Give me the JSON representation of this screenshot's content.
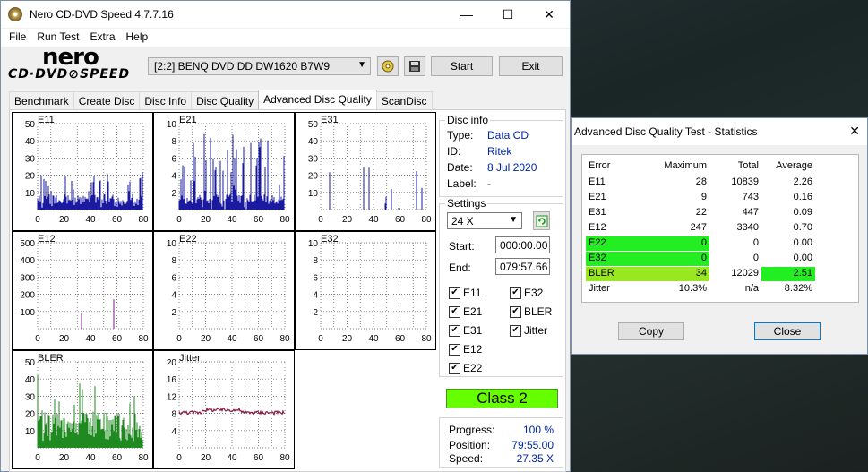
{
  "window": {
    "title": "Nero CD-DVD Speed 4.7.7.16",
    "min": "—",
    "max": "☐",
    "close": "✕"
  },
  "menu": [
    "File",
    "Run Test",
    "Extra",
    "Help"
  ],
  "logo": {
    "line1": "nero",
    "line2": "CD·DVD⊘SPEED"
  },
  "drive": "[2:2]   BENQ DVD DD DW1620 B7W9",
  "buttons": {
    "start": "Start",
    "exit": "Exit"
  },
  "tabs": [
    "Benchmark",
    "Create Disc",
    "Disc Info",
    "Disc Quality",
    "Advanced Disc Quality",
    "ScanDisc"
  ],
  "active_tab": "Advanced Disc Quality",
  "charts": [
    {
      "name": "E11",
      "yticks": [
        "50",
        "40",
        "30",
        "20",
        "10"
      ],
      "xticks": [
        "0",
        "20",
        "40",
        "60",
        "80"
      ],
      "color": "#1a1aa0",
      "type": "spikes"
    },
    {
      "name": "E21",
      "yticks": [
        "10",
        "8",
        "6",
        "4",
        "2"
      ],
      "xticks": [
        "0",
        "20",
        "40",
        "60",
        "80"
      ],
      "color": "#1a1aa0",
      "type": "spikes"
    },
    {
      "name": "E31",
      "yticks": [
        "50",
        "40",
        "30",
        "20",
        "10"
      ],
      "xticks": [
        "0",
        "20",
        "40",
        "60",
        "80"
      ],
      "color": "#1a1aa0",
      "type": "sparse"
    },
    {
      "name": "E12",
      "yticks": [
        "500",
        "400",
        "300",
        "200",
        "100"
      ],
      "xticks": [
        "0",
        "20",
        "40",
        "60",
        "80"
      ],
      "color": "#7a1a8a",
      "type": "sparse"
    },
    {
      "name": "E22",
      "yticks": [
        "10",
        "8",
        "6",
        "4",
        "2"
      ],
      "xticks": [
        "0",
        "20",
        "40",
        "60",
        "80"
      ],
      "color": "#1a1aa0",
      "type": "empty"
    },
    {
      "name": "E32",
      "yticks": [
        "10",
        "8",
        "6",
        "4",
        "2"
      ],
      "xticks": [
        "0",
        "20",
        "40",
        "60",
        "80"
      ],
      "color": "#1a1aa0",
      "type": "empty"
    },
    {
      "name": "BLER",
      "yticks": [
        "50",
        "40",
        "30",
        "20",
        "10"
      ],
      "xticks": [
        "0",
        "20",
        "40",
        "60",
        "80"
      ],
      "color": "#1f8a1f",
      "type": "bler"
    },
    {
      "name": "Jitter",
      "yticks": [
        "20",
        "16",
        "12",
        "8",
        "4"
      ],
      "xticks": [
        "0",
        "20",
        "40",
        "60",
        "80"
      ],
      "color": "#8a1a3a",
      "type": "jitter"
    }
  ],
  "disc_info": {
    "label": "Disc info",
    "type_label": "Type:",
    "type": "Data CD",
    "id_label": "ID:",
    "id": "Ritek",
    "date_label": "Date:",
    "date": "8 Jul 2020",
    "label_label": "Label:",
    "label_val": "-"
  },
  "settings": {
    "label": "Settings",
    "speed": "24 X",
    "start_label": "Start:",
    "start": "000:00.00",
    "end_label": "End:",
    "end": "079:57.66"
  },
  "checkboxes": [
    {
      "label": "E11",
      "checked": true
    },
    {
      "label": "E32",
      "checked": true
    },
    {
      "label": "E21",
      "checked": true
    },
    {
      "label": "BLER",
      "checked": true
    },
    {
      "label": "E31",
      "checked": true
    },
    {
      "label": "Jitter",
      "checked": true
    },
    {
      "label": "E12",
      "checked": true
    },
    {
      "label": "E22",
      "checked": true
    }
  ],
  "class": "Class 2",
  "progress": {
    "progress_label": "Progress:",
    "progress": "100 %",
    "position_label": "Position:",
    "position": "79:55.00",
    "speed_label": "Speed:",
    "speed": "27.35 X"
  },
  "stats": {
    "title": "Advanced Disc Quality Test - Statistics",
    "headers": [
      "Error",
      "Maximum",
      "Total",
      "Average"
    ],
    "rows": [
      {
        "error": "E11",
        "max": "28",
        "total": "10839",
        "avg": "2.26",
        "hl_err": "",
        "hl_avg": ""
      },
      {
        "error": "E21",
        "max": "9",
        "total": "743",
        "avg": "0.16",
        "hl_err": "",
        "hl_avg": ""
      },
      {
        "error": "E31",
        "max": "22",
        "total": "447",
        "avg": "0.09",
        "hl_err": "",
        "hl_avg": ""
      },
      {
        "error": "E12",
        "max": "247",
        "total": "3340",
        "avg": "0.70",
        "hl_err": "",
        "hl_avg": ""
      },
      {
        "error": "E22",
        "max": "0",
        "total": "0",
        "avg": "0.00",
        "hl_err": "#22ee22",
        "hl_avg": ""
      },
      {
        "error": "E32",
        "max": "0",
        "total": "0",
        "avg": "0.00",
        "hl_err": "#22ee22",
        "hl_avg": ""
      },
      {
        "error": "BLER",
        "max": "34",
        "total": "12029",
        "avg": "2.51",
        "hl_err": "#99e622",
        "hl_avg": "#22ee22"
      },
      {
        "error": "Jitter",
        "max": "10.3%",
        "total": "n/a",
        "avg": "8.32%",
        "hl_err": "",
        "hl_avg": ""
      }
    ],
    "copy": "Copy",
    "close": "Close"
  }
}
